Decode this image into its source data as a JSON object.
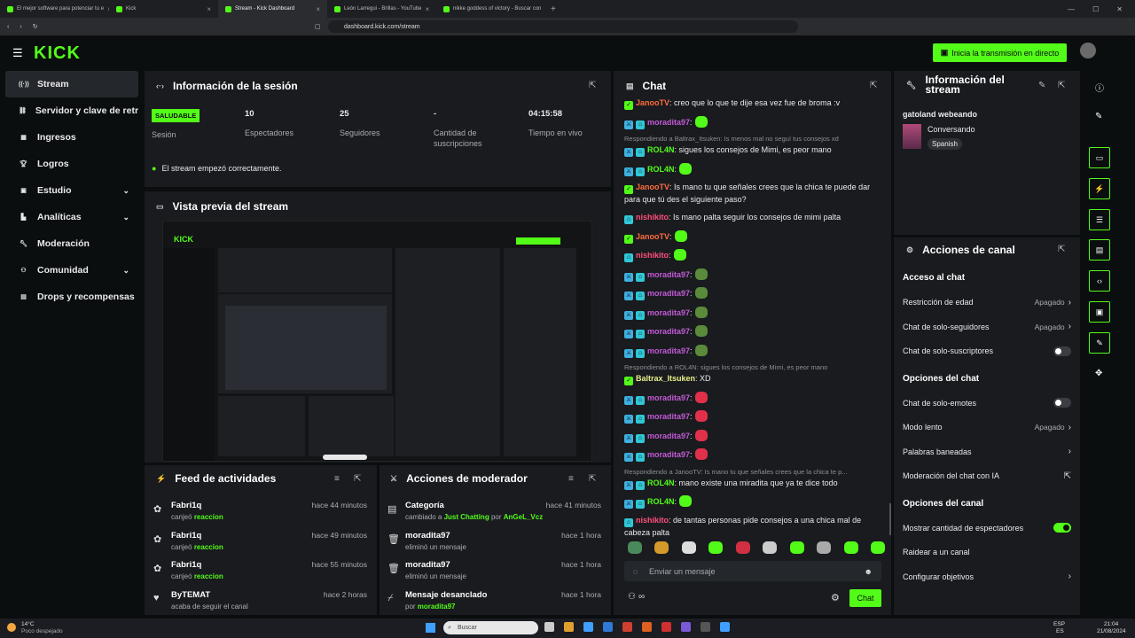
{
  "browser": {
    "tabs": [
      {
        "label": "El mejor software para potenciar tu e"
      },
      {
        "label": "Kick"
      },
      {
        "label": "Stream - Kick Dashboard",
        "active": true
      },
      {
        "label": "León Larregui - Brillas - YouTube"
      },
      {
        "label": "nikke goddess of victory - Buscar con"
      }
    ],
    "url": "dashboard.kick.com/stream"
  },
  "header": {
    "logo": "KICK",
    "go_live_label": "Inicia la transmisión en directo"
  },
  "sidebar": {
    "items": [
      {
        "label": "Stream",
        "icon": "broadcast-icon"
      },
      {
        "label": "Servidor y clave de retransmisión",
        "icon": "link-icon"
      },
      {
        "label": "Ingresos",
        "icon": "grid-icon"
      },
      {
        "label": "Logros",
        "icon": "trophy-icon"
      },
      {
        "label": "Estudio",
        "icon": "studio-icon"
      },
      {
        "label": "Analíticas",
        "icon": "chart-icon"
      },
      {
        "label": "Moderación",
        "icon": "wrench-icon"
      },
      {
        "label": "Comunidad",
        "icon": "community-icon"
      },
      {
        "label": "Drops y recompensas",
        "icon": "gift-icon"
      }
    ]
  },
  "session": {
    "title": "Información de la sesión",
    "status_badge": "SALUDABLE",
    "stats": [
      {
        "value": "",
        "label": "Sesión"
      },
      {
        "value": "10",
        "label": "Espectadores"
      },
      {
        "value": "25",
        "label": "Seguidores"
      },
      {
        "value": "-",
        "label": "Cantidad de suscripciones"
      },
      {
        "value": "04:15:58",
        "label": "Tiempo en vivo"
      }
    ],
    "notice": "El stream empezó correctamente."
  },
  "preview": {
    "title": "Vista previa del stream"
  },
  "activity": {
    "title": "Feed de actividades",
    "items": [
      {
        "name": "Fabri1q",
        "action": "canjeó",
        "highlight": "reaccion",
        "time": "hace 44 minutos"
      },
      {
        "name": "Fabri1q",
        "action": "canjeó",
        "highlight": "reaccion",
        "time": "hace 49 minutos"
      },
      {
        "name": "Fabri1q",
        "action": "canjeó",
        "highlight": "reaccion",
        "time": "hace 55 minutos"
      },
      {
        "name": "ByTEMAT",
        "action": "acaba de seguir el canal",
        "highlight": "",
        "time": "hace 2 horas"
      }
    ]
  },
  "modactions": {
    "title": "Acciones de moderador",
    "items": [
      {
        "name": "Categoría",
        "sub1": "cambiado a",
        "g1": "Just Chatting",
        "sub2": "por",
        "g2": "AnGeL_Vcz",
        "time": "hace 41 minutos"
      },
      {
        "name": "moradita97",
        "sub1": "eliminó un mensaje",
        "g1": "",
        "sub2": "",
        "g2": "",
        "time": "hace 1 hora"
      },
      {
        "name": "moradita97",
        "sub1": "eliminó un mensaje",
        "g1": "",
        "sub2": "",
        "g2": "",
        "time": "hace 1 hora"
      },
      {
        "name": "Mensaje desanclado",
        "sub1": "por",
        "g1": "moradita97",
        "sub2": "",
        "g2": "",
        "time": "hace 1 hora"
      }
    ]
  },
  "chat": {
    "title": "Chat",
    "input_placeholder": "Enviar un mensaje",
    "send_label": "Chat",
    "infinity": "∞",
    "messages": [
      {
        "reply": "",
        "user": "JanooTV",
        "color": "#ff6b3d",
        "badges": [
          "g"
        ],
        "text": ": creo que lo que te dije esa vez fue de broma :v",
        "emotes": []
      },
      {
        "reply": "",
        "user": "moradita97",
        "color": "#c25ad6",
        "badges": [
          "b",
          "c"
        ],
        "text": ":",
        "emotes": [
          "#53fc18"
        ]
      },
      {
        "reply": "Respondiendo a Baltrax_Itsuken: Is menos mal no seguí tus consejos xd",
        "user": "ROL4N",
        "color": "#53fc18",
        "badges": [
          "b",
          "c"
        ],
        "text": ": sigues los consejos de Mimi, es peor mano",
        "emotes": []
      },
      {
        "reply": "",
        "user": "ROL4N",
        "color": "#53fc18",
        "badges": [
          "b",
          "c"
        ],
        "text": ":",
        "emotes": [
          "#53fc18"
        ]
      },
      {
        "reply": "",
        "user": "JanooTV",
        "color": "#ff6b3d",
        "badges": [
          "g"
        ],
        "text": ": Is mano tu que señales crees que la chica te puede dar para que tú des el siguiente paso?",
        "emotes": []
      },
      {
        "reply": "",
        "user": "nishikito",
        "color": "#ff4f7b",
        "badges": [
          "c"
        ],
        "text": ": Is mano palta seguir los consejos de mimi palta",
        "emotes": []
      },
      {
        "reply": "",
        "user": "JanooTV",
        "color": "#ff6b3d",
        "badges": [
          "g"
        ],
        "text": ":",
        "emotes": [
          "#53fc18"
        ]
      },
      {
        "reply": "",
        "user": "nishikito",
        "color": "#ff4f7b",
        "badges": [
          "c"
        ],
        "text": ":",
        "emotes": [
          "#53fc18"
        ]
      },
      {
        "reply": "",
        "user": "moradita97",
        "color": "#c25ad6",
        "badges": [
          "b",
          "c"
        ],
        "text": ":",
        "emotes": [
          "#5a8a3a"
        ]
      },
      {
        "reply": "",
        "user": "moradita97",
        "color": "#c25ad6",
        "badges": [
          "b",
          "c"
        ],
        "text": ":",
        "emotes": [
          "#5a8a3a"
        ]
      },
      {
        "reply": "",
        "user": "moradita97",
        "color": "#c25ad6",
        "badges": [
          "b",
          "c"
        ],
        "text": ":",
        "emotes": [
          "#5a8a3a"
        ]
      },
      {
        "reply": "",
        "user": "moradita97",
        "color": "#c25ad6",
        "badges": [
          "b",
          "c"
        ],
        "text": ":",
        "emotes": [
          "#5a8a3a"
        ]
      },
      {
        "reply": "",
        "user": "moradita97",
        "color": "#c25ad6",
        "badges": [
          "b",
          "c"
        ],
        "text": ":",
        "emotes": [
          "#5a8a3a"
        ]
      },
      {
        "reply": "Respondiendo a ROL4N: sigues los consejos de Mimi, es peor mano",
        "user": "Baltrax_Itsuken",
        "color": "#e8f08a",
        "badges": [
          "g"
        ],
        "text": ": XD",
        "emotes": []
      },
      {
        "reply": "",
        "user": "moradita97",
        "color": "#c25ad6",
        "badges": [
          "b",
          "c"
        ],
        "text": ":",
        "emotes": [
          "#e0304a"
        ]
      },
      {
        "reply": "",
        "user": "moradita97",
        "color": "#c25ad6",
        "badges": [
          "b",
          "c"
        ],
        "text": ":",
        "emotes": [
          "#e0304a"
        ]
      },
      {
        "reply": "",
        "user": "moradita97",
        "color": "#c25ad6",
        "badges": [
          "b",
          "c"
        ],
        "text": ":",
        "emotes": [
          "#e0304a"
        ]
      },
      {
        "reply": "",
        "user": "moradita97",
        "color": "#c25ad6",
        "badges": [
          "b",
          "c"
        ],
        "text": ":",
        "emotes": [
          "#e0304a"
        ]
      },
      {
        "reply": "Respondiendo a JanooTV: Is mano tu que señales crees que la chica te p...",
        "user": "ROL4N",
        "color": "#53fc18",
        "badges": [
          "b",
          "c"
        ],
        "text": ": mano existe una miradita que ya te dice todo",
        "emotes": []
      },
      {
        "reply": "",
        "user": "ROL4N",
        "color": "#53fc18",
        "badges": [
          "b",
          "c"
        ],
        "text": ":",
        "emotes": [
          "#53fc18"
        ]
      },
      {
        "reply": "",
        "user": "nishikito",
        "color": "#ff4f7b",
        "badges": [
          "c"
        ],
        "text": ": de tantas personas pide consejos a una chica mal de cabeza palta",
        "emotes": []
      },
      {
        "reply": "",
        "user": "nishikito",
        "color": "#ff4f7b",
        "badges": [
          "c"
        ],
        "text": ":",
        "emotes": [
          "#53fc18"
        ]
      }
    ],
    "emote_bar": [
      "#4a8a5a",
      "#d49a2a",
      "#dddddd",
      "#53fc18",
      "#d03040",
      "#cccccc",
      "#53fc18",
      "#aaaaaa",
      "#53fc18",
      "#53fc18"
    ]
  },
  "stream_info": {
    "title": "Información del stream",
    "stream_title": "gatoland webeando",
    "category": "Conversando",
    "language": "Spanish"
  },
  "channel_actions": {
    "title": "Acciones de canal",
    "sections": [
      {
        "heading": "Acceso al chat",
        "rows": [
          {
            "label": "Restricción de edad",
            "value": "Apagado",
            "kind": "chevron"
          },
          {
            "label": "Chat de solo-seguidores",
            "value": "Apagado",
            "kind": "chevron"
          },
          {
            "label": "Chat de solo-suscriptores",
            "value": "",
            "kind": "toggle-off"
          }
        ]
      },
      {
        "heading": "Opciones del chat",
        "rows": [
          {
            "label": "Chat de solo-emotes",
            "value": "",
            "kind": "toggle-off"
          },
          {
            "label": "Modo lento",
            "value": "Apagado",
            "kind": "chevron"
          },
          {
            "label": "Palabras baneadas",
            "value": "",
            "kind": "chevron"
          },
          {
            "label": "Moderación del chat con IA",
            "value": "",
            "kind": "external"
          }
        ]
      },
      {
        "heading": "Opciones del canal",
        "rows": [
          {
            "label": "Mostrar cantidad de espectadores",
            "value": "",
            "kind": "toggle-on"
          },
          {
            "label": "Raidear a un canal",
            "value": "",
            "kind": "none"
          },
          {
            "label": "Configurar objetivos",
            "value": "",
            "kind": "chevron"
          }
        ]
      }
    ]
  },
  "taskbar": {
    "weather_temp": "14°C",
    "weather_desc": "Poco despejado",
    "search_placeholder": "Buscar",
    "lang": "ESP",
    "region": "ES",
    "time": "21:04",
    "date": "21/08/2024"
  },
  "colors": {
    "accent": "#53fc18",
    "panel": "#191b1f",
    "background": "#0b0e0f"
  }
}
